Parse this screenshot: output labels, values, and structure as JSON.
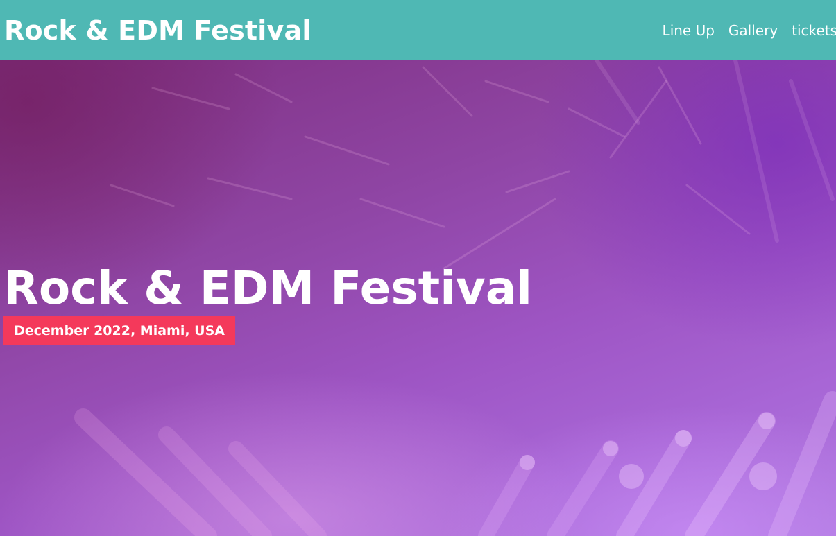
{
  "navbar": {
    "brand": "Rock & EDM Festival",
    "links": [
      {
        "label": "Line Up"
      },
      {
        "label": "Gallery"
      },
      {
        "label": "tickets"
      }
    ],
    "background_color": "#4fb8b4"
  },
  "hero": {
    "title": "Rock & EDM Festival",
    "badge": "December 2022, Miami, USA",
    "badge_color": "#f4395b",
    "background_image": "concert-stage-lights"
  }
}
